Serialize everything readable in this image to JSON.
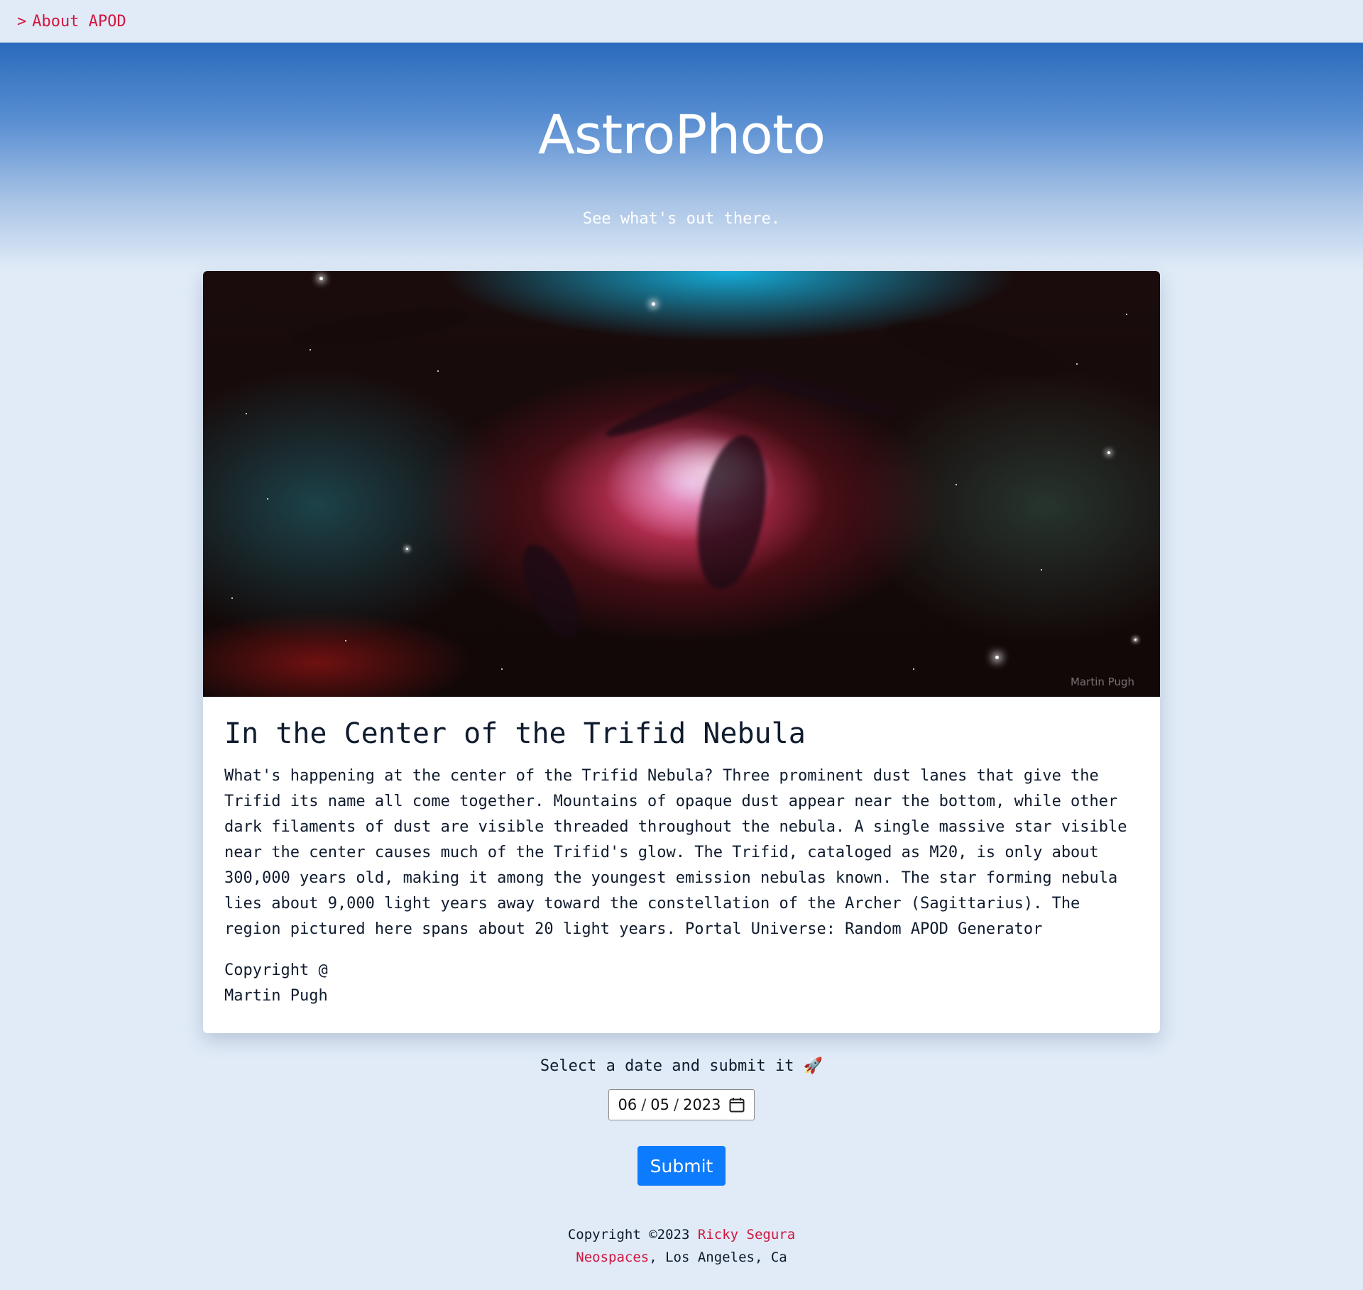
{
  "nav": {
    "chevron": ">",
    "about_label": "About APOD",
    "link_color": "#d1163f"
  },
  "hero": {
    "title": "AstroPhoto",
    "subtitle": "See what's out there."
  },
  "apod": {
    "image_alt": "In the Center of the Trifid Nebula",
    "image_credit_watermark": "Martin Pugh",
    "title": "In the Center of the Trifid Nebula",
    "explanation": "What's happening at the center of the Trifid Nebula? Three prominent dust lanes that give the Trifid its name all come together. Mountains of opaque dust appear near the bottom, while other dark filaments of dust are visible threaded throughout the nebula. A single massive star visible near the center causes much of the Trifid's glow. The Trifid, cataloged as M20, is only about 300,000 years old, making it among the youngest emission nebulas known. The star forming nebula lies about 9,000 light years away toward the constellation of the Archer (Sagittarius). The region pictured here spans about 20 light years. Portal Universe: Random APOD Generator",
    "copyright_label": "Copyright @",
    "copyright_name": "Martin Pugh"
  },
  "form": {
    "label": "Select a date and submit it",
    "label_emoji": "🚀",
    "date": {
      "month": "06",
      "day": "05",
      "year": "2023",
      "separator": "/"
    },
    "calendar_icon": "calendar-icon",
    "submit_label": "Submit",
    "submit_color": "#0d7bfd"
  },
  "footer": {
    "copyright_prefix": "Copyright ©2023",
    "author_name": "Ricky Segura",
    "company": "Neospaces",
    "location": ", Los Angeles, Ca"
  }
}
